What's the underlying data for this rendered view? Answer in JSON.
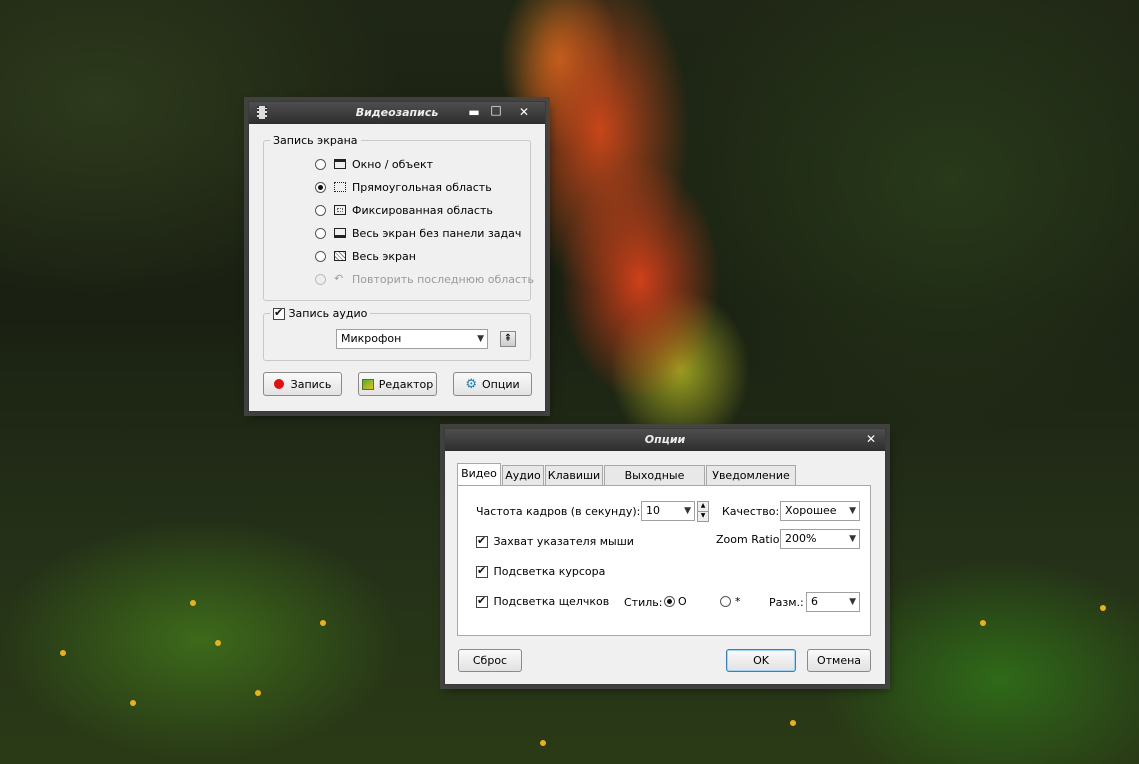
{
  "video_window": {
    "title": "Видеозапись",
    "minimize_glyph": "▬",
    "maximize_glyph": "□",
    "close_glyph": "✕",
    "screen_group_label": "Запись экрана",
    "options": [
      {
        "label": "Окно / объект",
        "selected": false,
        "disabled": false,
        "icon": "window-icon"
      },
      {
        "label": "Прямоугольная область",
        "selected": true,
        "disabled": false,
        "icon": "dotted-rect-icon"
      },
      {
        "label": "Фиксированная область",
        "selected": false,
        "disabled": false,
        "icon": "fixed-area-icon"
      },
      {
        "label": "Весь экран без панели задач",
        "selected": false,
        "disabled": false,
        "icon": "screen-no-taskbar-icon"
      },
      {
        "label": "Весь экран",
        "selected": false,
        "disabled": false,
        "icon": "fullscreen-icon"
      },
      {
        "label": "Повторить последнюю область",
        "selected": false,
        "disabled": true,
        "icon": "repeat-icon"
      }
    ],
    "audio_label": "Запись аудио",
    "audio_checked": true,
    "audio_source": "Микрофон",
    "record_button": "Запись",
    "editor_button": "Редактор",
    "options_button": "Опции"
  },
  "options_window": {
    "title": "Опции",
    "close_glyph": "✕",
    "tabs": [
      "Видео",
      "Аудио",
      "Клавиши",
      "Выходные файлы",
      "Уведомление"
    ],
    "active_tab": 0,
    "fps_label": "Частота кадров (в секунду):",
    "fps_value": "10",
    "quality_label": "Качество:",
    "quality_value": "Хорошее",
    "zoom_label": "Zoom Ratio:",
    "zoom_value": "200%",
    "capture_pointer_label": "Захват указателя мыши",
    "capture_pointer_checked": true,
    "cursor_highlight_label": "Подсветка курсора",
    "cursor_highlight_checked": true,
    "click_highlight_label": "Подсветка щелчков",
    "click_highlight_checked": true,
    "style_label": "Стиль:",
    "style_option_1": "O",
    "style_option_2": "*",
    "style_selected": 1,
    "size_label": "Разм.:",
    "size_value": "6",
    "reset_button": "Сброс",
    "ok_button": "OK",
    "cancel_button": "Отмена"
  },
  "colors": {
    "record_dot": "#e01010",
    "titlebar": "#3a3a3a"
  }
}
